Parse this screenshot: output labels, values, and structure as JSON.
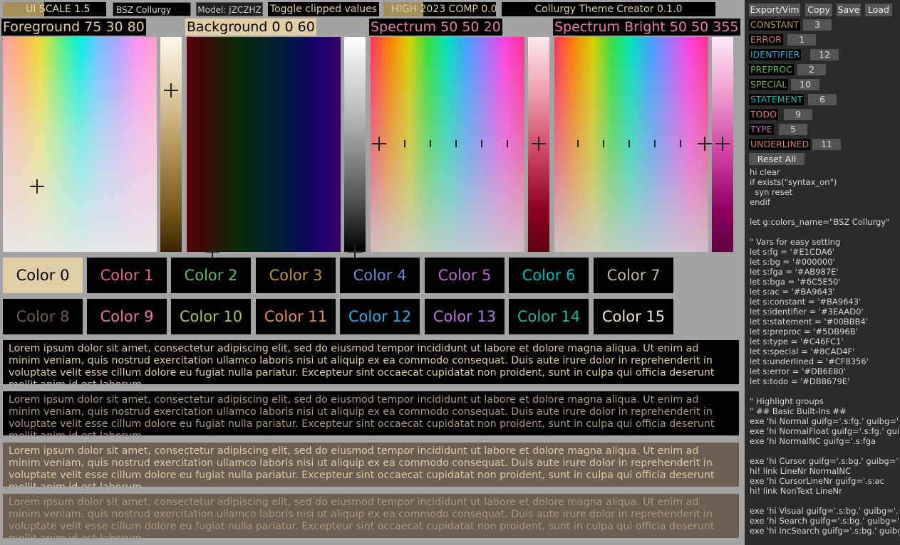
{
  "topbar": {
    "ui_scale": "UI SCALE 1.5",
    "theme_name": "BSZ Collurgy",
    "model": "Model: JZCZHZ",
    "toggle_clipped": "Toggle clipped values",
    "high_comp": "HIGH 2023 COMP 0.0",
    "title": "Collurgy Theme Creator 0.1.0"
  },
  "pickers": [
    {
      "label": "Foreground 75 30 80",
      "label_bg": "#000000",
      "label_fg": "#e1cda6"
    },
    {
      "label": "Background 0 0 60",
      "label_bg": "#e1cda6",
      "label_fg": "#000000"
    },
    {
      "label": "Spectrum 50 50 20",
      "label_bg": "#000000",
      "label_fg": "#e67fa8"
    },
    {
      "label": "Spectrum Bright 50 50 355",
      "label_bg": "#000000",
      "label_fg": "#e87fb0"
    }
  ],
  "colors": [
    {
      "label": "Color 0",
      "fg": "#000000",
      "bg": "#e1cda6"
    },
    {
      "label": "Color 1",
      "fg": "#db6e80",
      "bg": "#000000"
    },
    {
      "label": "Color 2",
      "fg": "#5db96b",
      "bg": "#000000"
    },
    {
      "label": "Color 3",
      "fg": "#ba9643",
      "bg": "#000000"
    },
    {
      "label": "Color 4",
      "fg": "#6c8ad0",
      "bg": "#000000"
    },
    {
      "label": "Color 5",
      "fg": "#b76ccd",
      "bg": "#000000"
    },
    {
      "label": "Color 6",
      "fg": "#00bbb4",
      "bg": "#000000"
    },
    {
      "label": "Color 7",
      "fg": "#c8b8a0",
      "bg": "#000000"
    },
    {
      "label": "Color 8",
      "fg": "#6c5e50",
      "bg": "#000000"
    },
    {
      "label": "Color 9",
      "fg": "#e8799a",
      "bg": "#000000"
    },
    {
      "label": "Color 10",
      "fg": "#a6c46a",
      "bg": "#000000"
    },
    {
      "label": "Color 11",
      "fg": "#e38b5e",
      "bg": "#000000"
    },
    {
      "label": "Color 12",
      "fg": "#3ea6e0",
      "bg": "#000000"
    },
    {
      "label": "Color 13",
      "fg": "#b07ad8",
      "bg": "#000000"
    },
    {
      "label": "Color 14",
      "fg": "#1fb79a",
      "bg": "#000000"
    },
    {
      "label": "Color 15",
      "fg": "#f0e6d2",
      "bg": "#000000"
    }
  ],
  "lorem": {
    "text": "Lorem ipsum dolor sit amet, consectetur adipiscing elit, sed do eiusmod tempor incididunt ut labore et dolore magna aliqua. Ut enim ad minim veniam, quis nostrud exercitation ullamco laboris nisi ut aliquip ex ea commodo consequat. Duis aute irure dolor in reprehenderit in voluptate velit esse cillum dolore eu fugiat nulla pariatur. Excepteur sint occaecat cupidatat non proident, sunt in culpa qui officia deserunt mollit anim id est laborum.",
    "blocks": [
      {
        "fg": "#e1cda6",
        "bg": "#000000"
      },
      {
        "fg": "#ab987e",
        "bg": "#000000"
      },
      {
        "fg": "#e1cda6",
        "bg": "#6c5e50"
      },
      {
        "fg": "#ab987e",
        "bg": "#6c5e50"
      }
    ]
  },
  "panel": {
    "buttons": [
      "Export/Vim",
      "Copy",
      "Save",
      "Load"
    ],
    "highlights": [
      {
        "name": "CONSTANT",
        "value": "3",
        "color": "#ba9643"
      },
      {
        "name": "ERROR",
        "value": "1",
        "color": "#db6e80"
      },
      {
        "name": "IDENTIFIER",
        "value": "12",
        "color": "#3eaad0"
      },
      {
        "name": "PREPROC",
        "value": "2",
        "color": "#5db96b"
      },
      {
        "name": "SPECIAL",
        "value": "10",
        "color": "#8cad4f"
      },
      {
        "name": "STATEMENT",
        "value": "6",
        "color": "#00bbb4"
      },
      {
        "name": "TODO",
        "value": "9",
        "color": "#db8679"
      },
      {
        "name": "TYPE",
        "value": "5",
        "color": "#c46fc1"
      },
      {
        "name": "UNDERLINED",
        "value": "11",
        "color": "#cf8356"
      }
    ],
    "reset_all": "Reset All",
    "vim_code": "hi clear\nif exists(\"syntax_on\")\n  syn reset\nendif\n\nlet g:colors_name=\"BSZ Collurgy\"\n\n\" Vars for easy setting\nlet s:fg = '#E1CDA6'\nlet s:bg = '#000000'\nlet s:fga = '#AB987E'\nlet s:bga = '#6C5E50'\nlet s:ac = '#BA9643'\nlet s:constant = '#BA9643'\nlet s:identifier = '#3EAAD0'\nlet s:statement = '#00BBB4'\nlet s:preproc = '#5DB96B'\nlet s:type = '#C46FC1'\nlet s:special = '#8CAD4F'\nlet s:underlined = '#CF8356'\nlet s:error = '#DB6E80'\nlet s:todo = '#DB8679E'\n\n\" Highlight groups\n\" ## Basic Built-Ins ##\nexe 'hi Normal guifg='.s:fg.' guibg='.s:\nexe 'hi NormalFloat guifg='.s:fg.' guib\nexe 'hi NormalNC guifg='.s:fga\n\nexe 'hi Cursor guifg='.s:bg.' guibg='.s:\nhi! link LineNr NormalNC\nexe 'hi CursorLineNr guifg='.s:ac\nhi! link NonText LineNr\n\nexe 'hi Visual guifg='.s:bg.' guibg='.s:\nexe 'hi Search guifg='.s:bg.' guibg='.s:\nexe 'hi IncSearch guifg='.s:bg.' guibg="
  }
}
